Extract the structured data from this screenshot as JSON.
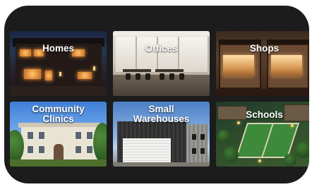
{
  "categories": [
    {
      "id": "homes",
      "label": "Homes"
    },
    {
      "id": "offices",
      "label": "Offices"
    },
    {
      "id": "shops",
      "label": "Shops"
    },
    {
      "id": "clinics",
      "label": "Community\nClinics"
    },
    {
      "id": "warehouses",
      "label": "Small\nWarehouses"
    },
    {
      "id": "schools",
      "label": "Schools"
    }
  ],
  "colors": {
    "panel_background": "#1c1c1c",
    "page_background": "#ffffff",
    "label_text": "#ffffff"
  }
}
